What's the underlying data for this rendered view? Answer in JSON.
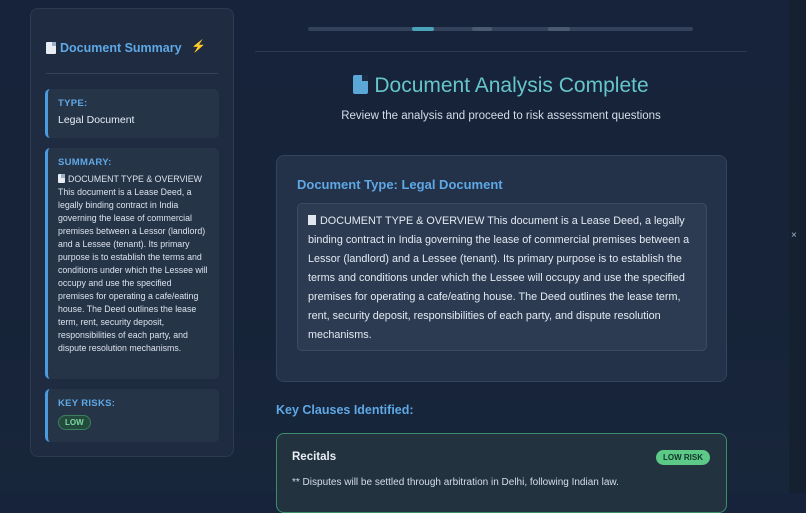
{
  "sidebar": {
    "title": "Document Summary",
    "bolt": "⚡",
    "type_label": "TYPE:",
    "type_value": "Legal Document",
    "summary_label": "SUMMARY:",
    "summary_text": "DOCUMENT TYPE & OVERVIEW This document is a Lease Deed, a legally binding contract in India governing the lease of commercial premises between a Lessor (landlord) and a Lessee (tenant). Its primary purpose is to establish the terms and conditions under which the Lessee will occupy and use the specified premises for operating a cafe/eating house. The Deed outlines the lease term, rent, security deposit, responsibilities of each party, and dispute resolution mechanisms.",
    "risks_label": "KEY RISKS:",
    "risk_badge": "LOW"
  },
  "main": {
    "heading": "Document Analysis Complete",
    "subtitle": "Review the analysis and proceed to risk assessment questions",
    "doc_type_title": "Document Type: Legal Document",
    "overview_text": "DOCUMENT TYPE & OVERVIEW This document is a Lease Deed, a legally binding contract in India governing the lease of commercial premises between a Lessor (landlord) and a Lessee (tenant). Its primary purpose is to establish the terms and conditions under which the Lessee will occupy and use the specified premises for operating a cafe/eating house. The Deed outlines the lease term, rent, security deposit, responsibilities of each party, and dispute resolution mechanisms.",
    "key_clauses_title": "Key Clauses Identified:",
    "clauses": [
      {
        "name": "Recitals",
        "risk": "LOW RISK",
        "text": "** Disputes will be settled through arbitration in Delhi, following Indian law."
      }
    ]
  },
  "close_glyph": "×",
  "colors": {
    "accent_blue": "#5fa8e6",
    "heading_teal": "#66c5c9",
    "low_risk_green": "#5cc987"
  },
  "icons": [
    "document-icon",
    "bolt-icon",
    "close-icon"
  ]
}
